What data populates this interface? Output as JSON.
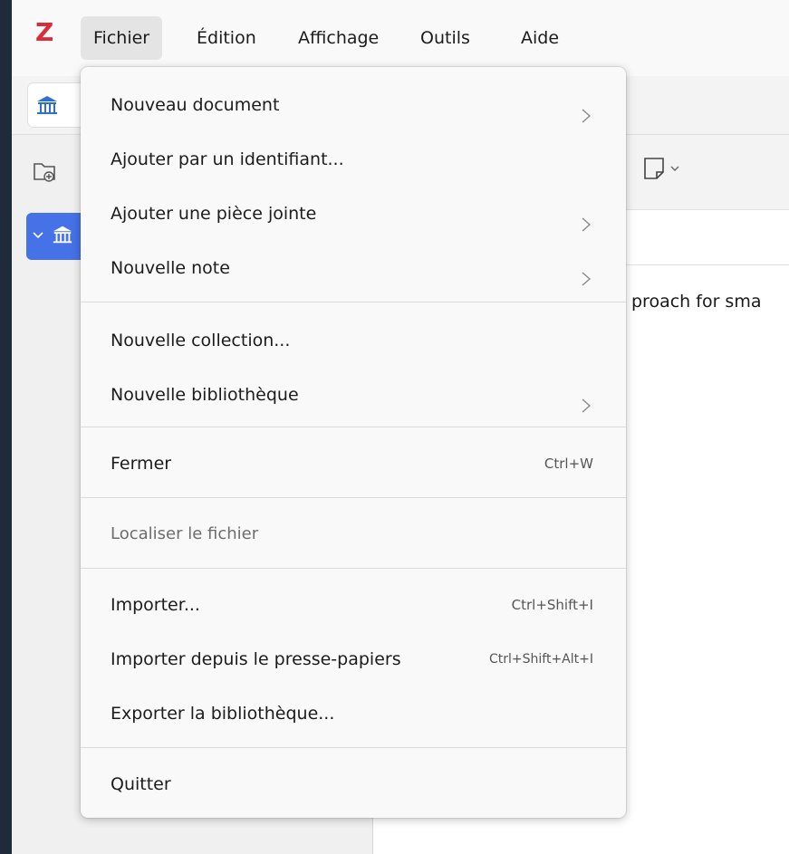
{
  "menubar": {
    "logo": "Z",
    "items": [
      "Fichier",
      "Édition",
      "Affichage",
      "Outils",
      "Aide"
    ]
  },
  "content": {
    "row_text": "proach for sma"
  },
  "file_menu": {
    "items": [
      {
        "label": "Nouveau document",
        "submenu": true
      },
      {
        "label": "Ajouter par un identifiant..."
      },
      {
        "label": "Ajouter une pièce jointe",
        "submenu": true
      },
      {
        "label": "Nouvelle note",
        "submenu": true
      },
      {
        "label": "Nouvelle collection..."
      },
      {
        "label": "Nouvelle bibliothèque",
        "submenu": true
      },
      {
        "label": "Fermer",
        "shortcut": "Ctrl+W"
      },
      {
        "label": "Localiser le fichier",
        "disabled": true
      },
      {
        "label": "Importer...",
        "shortcut": "Ctrl+Shift+I"
      },
      {
        "label": "Importer depuis le presse-papiers",
        "shortcut": "Ctrl+Shift+Alt+I"
      },
      {
        "label": "Exporter la bibliothèque..."
      },
      {
        "label": "Quitter"
      }
    ]
  },
  "colors": {
    "accent": "#4572e6",
    "logo": "#db2c3a",
    "dark_background": "#1f2b38"
  }
}
